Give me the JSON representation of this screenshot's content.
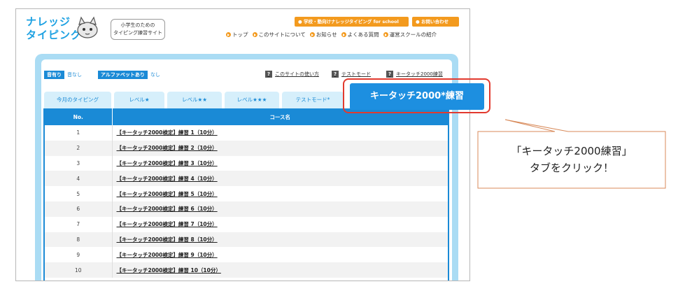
{
  "header": {
    "logo_line1": "ナレッジ",
    "logo_line2": "タイピング",
    "tagline_line1": "小学生のための",
    "tagline_line2": "タイピング練習サイト",
    "school_button": "学校・塾向けナレッジタイピング for school",
    "contact_button": "お問い合わせ",
    "nav": [
      "トップ",
      "このサイトについて",
      "お知らせ",
      "よくある質問",
      "運営スクールの紹介"
    ]
  },
  "controls": {
    "sound_on": "音有り",
    "sound_off": "音なし",
    "alpha_on": "アルファベットあり",
    "alpha_off": "なし",
    "help_links": [
      "このサイトの使い方",
      "テストモード",
      "キータッチ2000練習"
    ]
  },
  "tabs": [
    "今月のタイピング",
    "レベル★",
    "レベル★★",
    "レベル★★★",
    "テストモード*"
  ],
  "highlighted_tab": "キータッチ2000*練習",
  "table": {
    "headers": [
      "No.",
      "コース名"
    ],
    "rows": [
      {
        "no": "1",
        "name": "【キータッチ2000検定】練習 1（10分）"
      },
      {
        "no": "2",
        "name": "【キータッチ2000検定】練習 2（10分）"
      },
      {
        "no": "3",
        "name": "【キータッチ2000検定】練習 3（10分）"
      },
      {
        "no": "4",
        "name": "【キータッチ2000検定】練習 4（10分）"
      },
      {
        "no": "5",
        "name": "【キータッチ2000検定】練習 5（10分）"
      },
      {
        "no": "6",
        "name": "【キータッチ2000検定】練習 6（10分）"
      },
      {
        "no": "7",
        "name": "【キータッチ2000検定】練習 7（10分）"
      },
      {
        "no": "8",
        "name": "【キータッチ2000検定】練習 8（10分）"
      },
      {
        "no": "9",
        "name": "【キータッチ2000検定】練習 9（10分）"
      },
      {
        "no": "10",
        "name": "【キータッチ2000検定】練習 10（10分）"
      }
    ]
  },
  "callout": {
    "line1": "「キータッチ2000練習」",
    "line2": "タブをクリック！"
  },
  "colors": {
    "primary_blue": "#1a8ad6",
    "accent_orange": "#f39a1e",
    "highlight_red": "#e23a2e",
    "panel_light_blue": "#aadcf4",
    "callout_border": "#d88a5a"
  }
}
